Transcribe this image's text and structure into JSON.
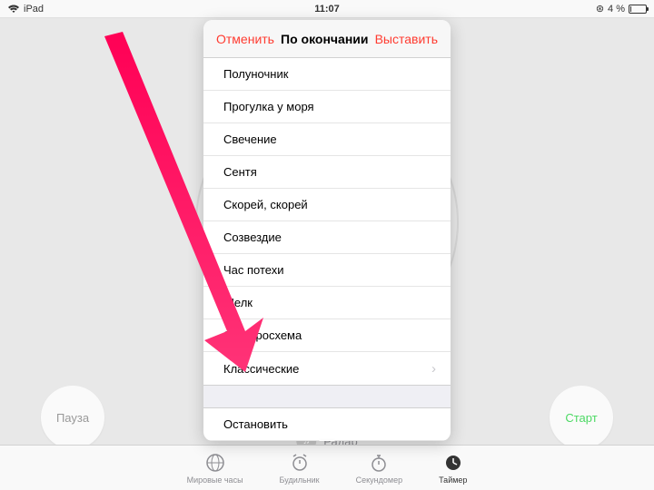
{
  "status": {
    "device": "iPad",
    "time": "11:07",
    "battery": "4 %",
    "lock": "⊛"
  },
  "modal": {
    "cancel": "Отменить",
    "title": "По окончании",
    "set": "Выставить",
    "items": [
      {
        "label": "Полуночник"
      },
      {
        "label": "Прогулка у моря"
      },
      {
        "label": "Свечение"
      },
      {
        "label": "Сентя"
      },
      {
        "label": "Скорей, скорей"
      },
      {
        "label": "Созвездие"
      },
      {
        "label": "Час потехи"
      },
      {
        "label": "Шелк"
      },
      {
        "label": "Электросхема"
      },
      {
        "label": "Классические",
        "has_chevron": true
      }
    ],
    "stop": "Остановить"
  },
  "buttons": {
    "pause": "Пауза",
    "start": "Старт"
  },
  "sound": {
    "label": "Радар"
  },
  "tabs": [
    {
      "label": "Мировые часы"
    },
    {
      "label": "Будильник"
    },
    {
      "label": "Секундомер"
    },
    {
      "label": "Таймер",
      "active": true
    }
  ]
}
